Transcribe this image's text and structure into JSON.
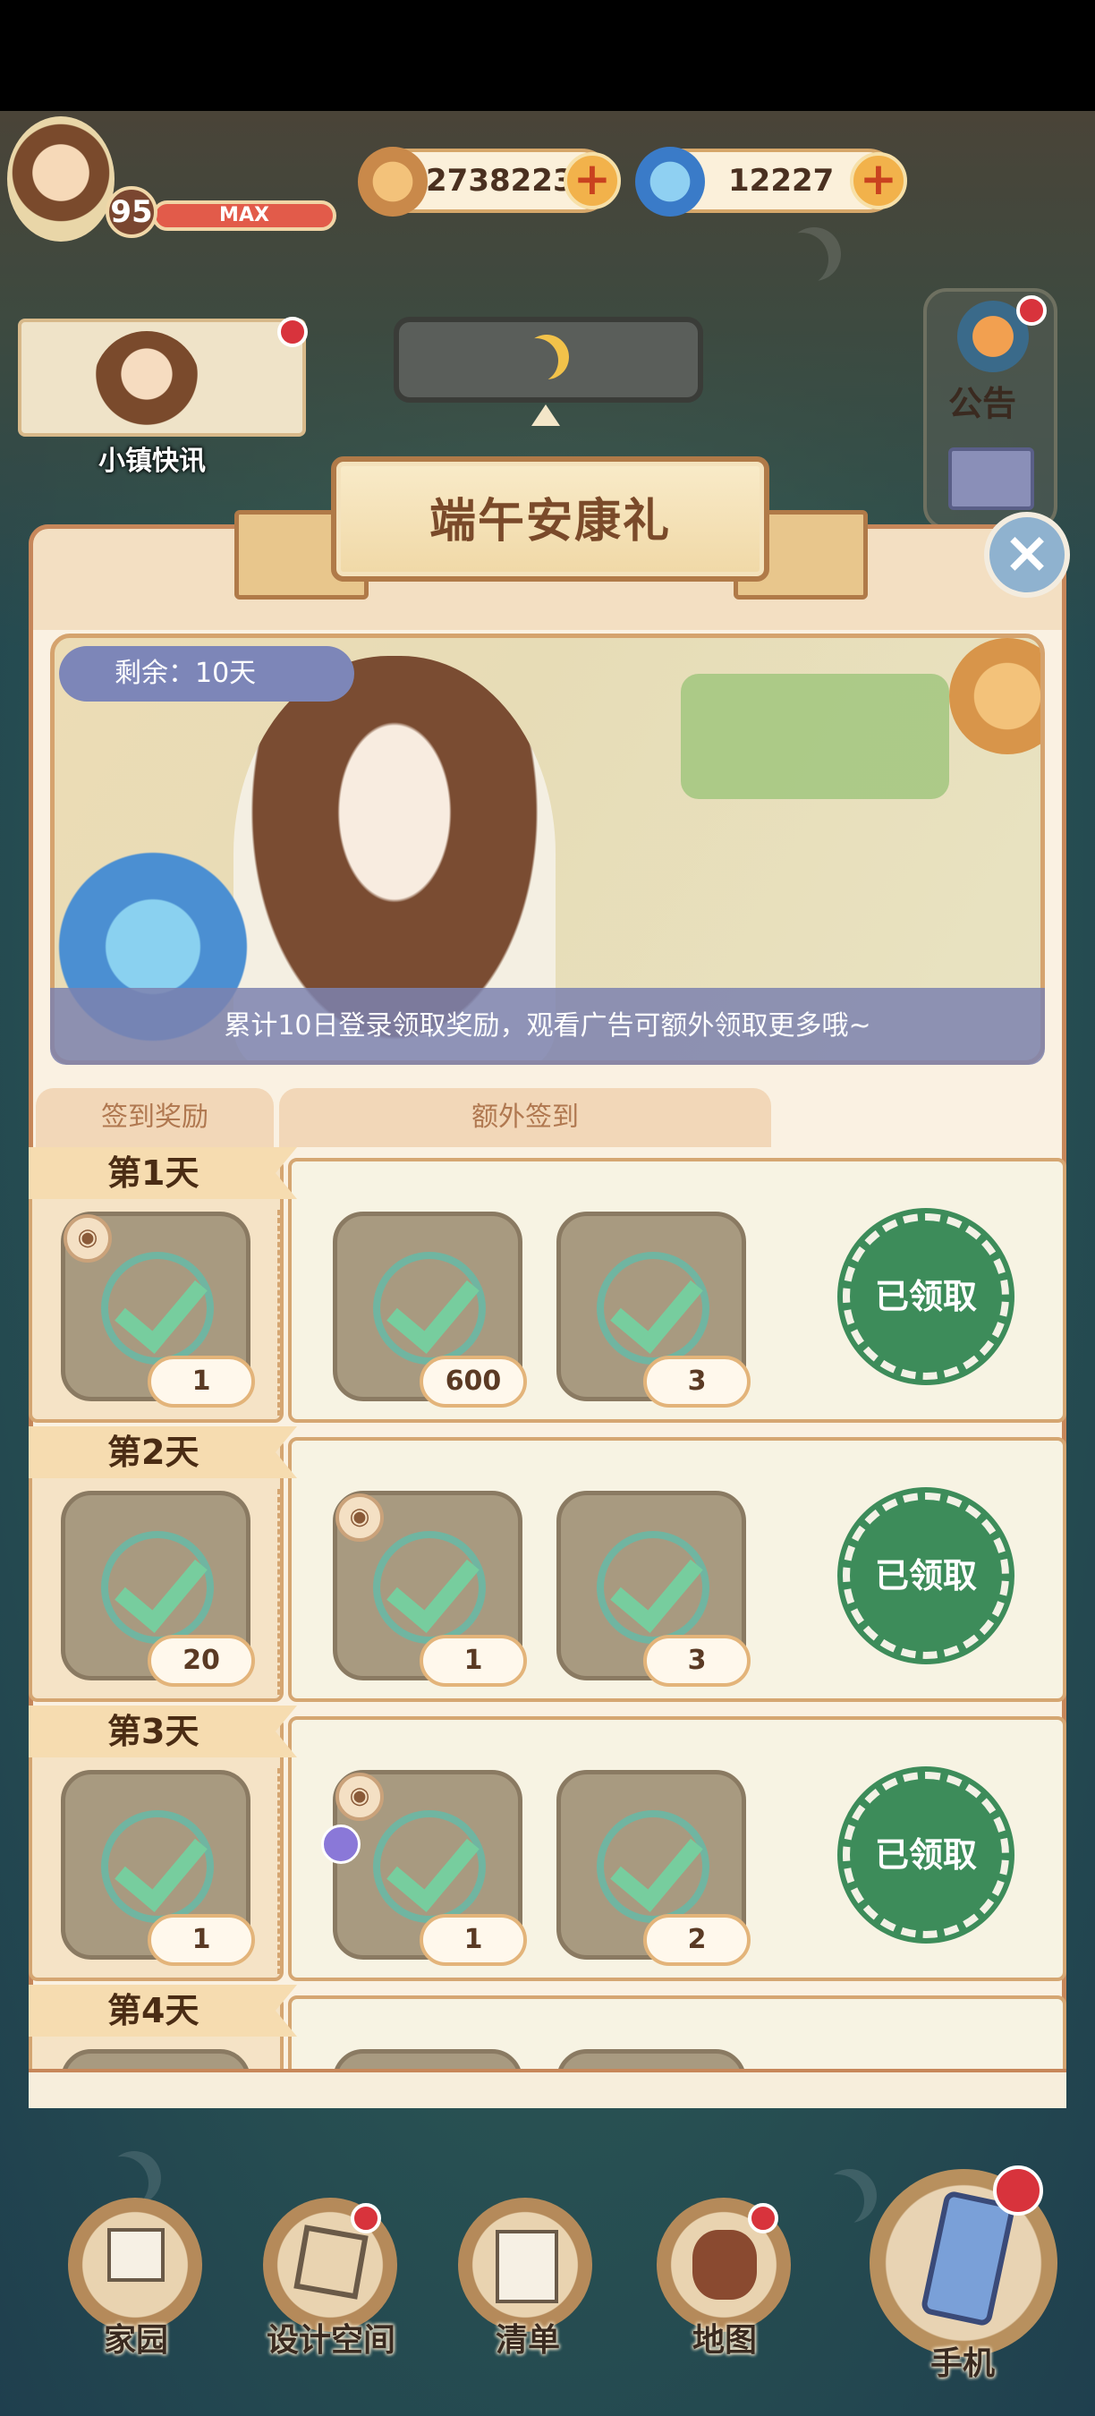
{
  "hud": {
    "level": "95",
    "level_status": "MAX",
    "coins": "2738223",
    "gems": "12227",
    "news_label": "小镇快讯",
    "notice_label": "公告"
  },
  "modal": {
    "title": "端午安康礼",
    "remaining": "剩余：10天",
    "description": "累计10日登录领取奖励，观看广告可额外领取更多哦~",
    "tabs": [
      "签到奖励",
      "额外签到"
    ],
    "days": [
      {
        "label": "第1天",
        "rewards": [
          "1",
          "600",
          "3"
        ],
        "status": "已领取"
      },
      {
        "label": "第2天",
        "rewards": [
          "20",
          "1",
          "3"
        ],
        "status": "已领取"
      },
      {
        "label": "第3天",
        "rewards": [
          "1",
          "1",
          "2"
        ],
        "status": "已领取"
      },
      {
        "label": "第4天",
        "rewards": [],
        "status": ""
      }
    ]
  },
  "dock": {
    "items": [
      "家园",
      "设计空间",
      "清单",
      "地图",
      "手机"
    ]
  },
  "colors": {
    "accent_green": "#3d8c5a",
    "badge_red": "#d8333c",
    "frame_brown": "#c7875a"
  }
}
